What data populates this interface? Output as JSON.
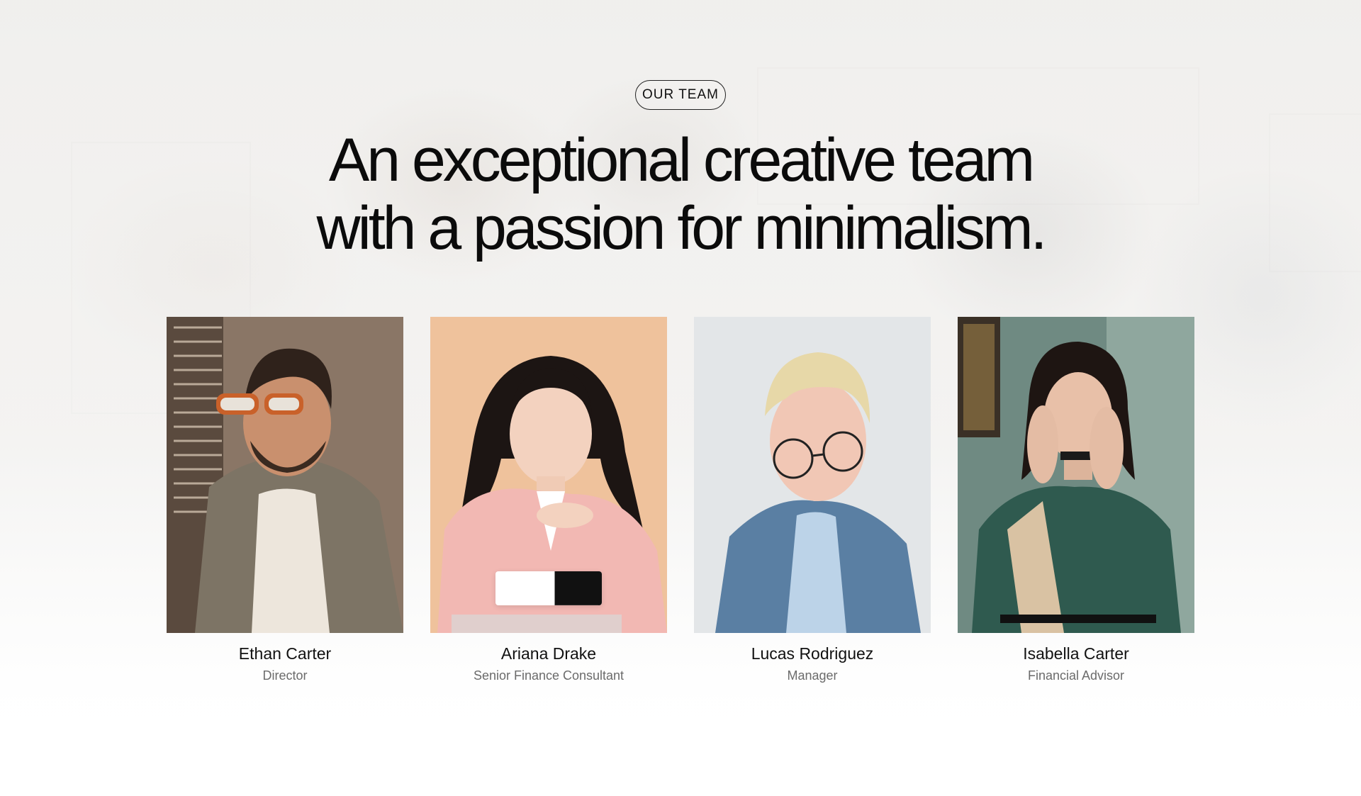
{
  "section_label": "OUR TEAM",
  "headline": {
    "line1": "An exceptional creative team",
    "line2": "with a passion for minimalism."
  },
  "team": [
    {
      "name": "Ethan Carter",
      "role": "Director"
    },
    {
      "name": "Ariana Drake",
      "role": "Senior Finance Consultant"
    },
    {
      "name": "Lucas Rodriguez",
      "role": "Manager"
    },
    {
      "name": "Isabella Carter",
      "role": "Financial Advisor"
    }
  ],
  "social_icons": [
    "facebook-icon",
    "instagram-icon",
    "twitter-icon"
  ],
  "colors": {
    "text": "#111111",
    "role_text": "#6b6b6b",
    "background": "#f3f3f2"
  }
}
